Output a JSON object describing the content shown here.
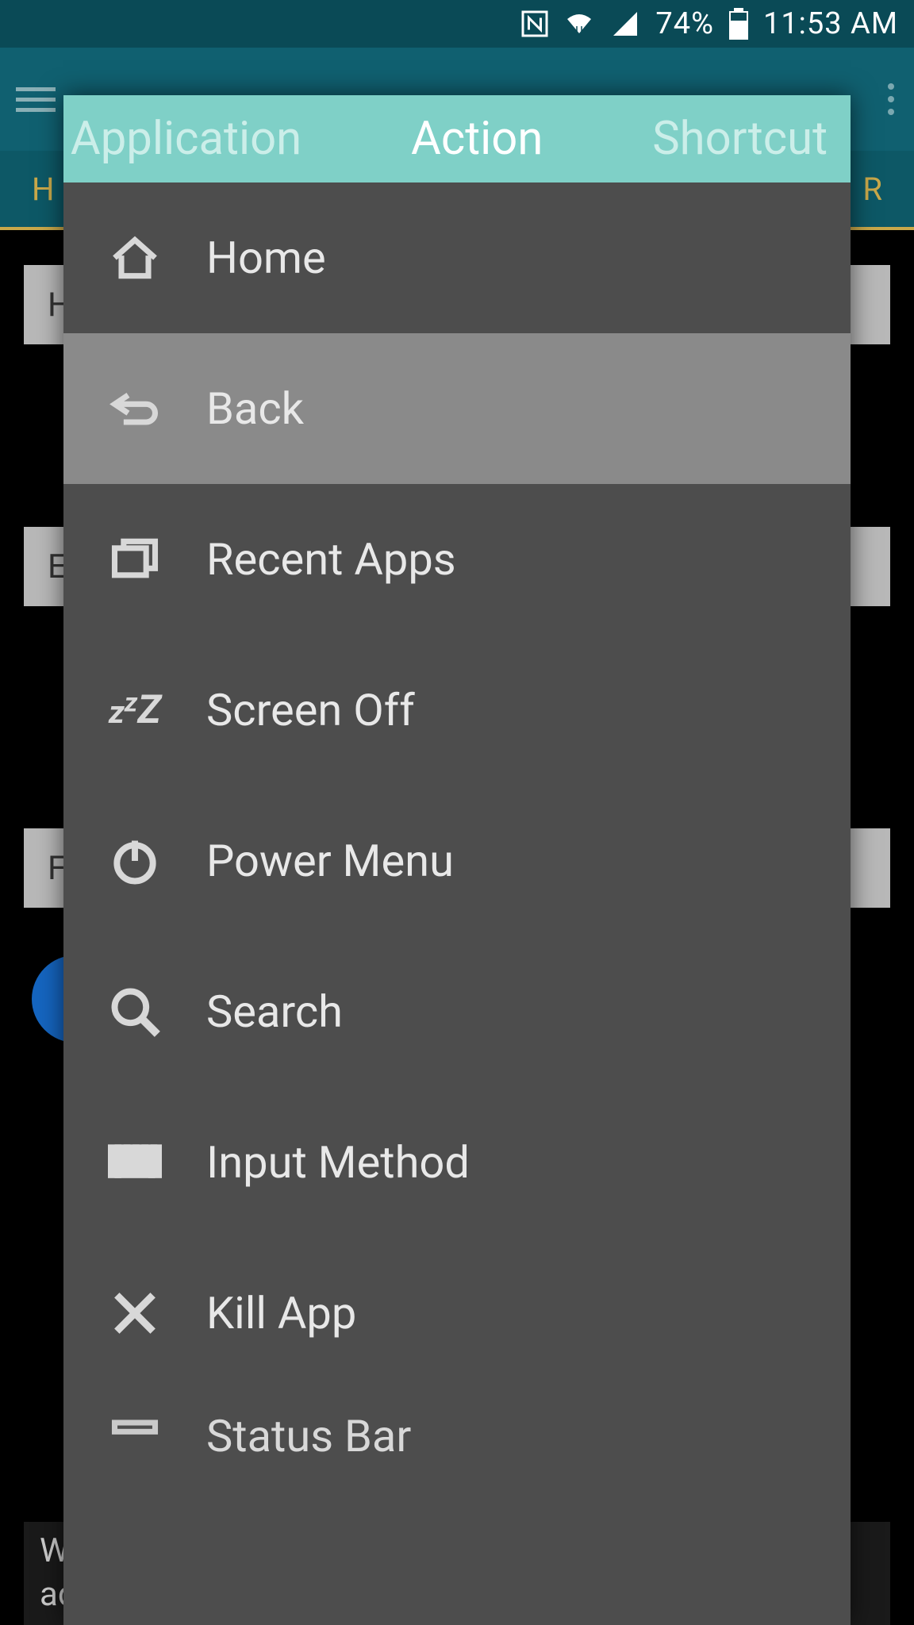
{
  "status_bar": {
    "nfc_icon": "N",
    "wifi_icon": "wifi",
    "signal_icon": "signal",
    "battery_percent": "74%",
    "battery_icon": "battery",
    "time": "11:53 AM"
  },
  "background": {
    "tabs_left_char": "H",
    "tabs_right_char": "R",
    "row1_char": "H",
    "row2_char": "E",
    "row3_char": "F",
    "footer_line1": "Wo",
    "footer_line2": "ad-free version?"
  },
  "dialog": {
    "tabs": {
      "left": "Application",
      "center": "Action",
      "right": "Shortcut"
    },
    "actions": [
      {
        "icon": "home",
        "label": "Home"
      },
      {
        "icon": "back",
        "label": "Back"
      },
      {
        "icon": "recent",
        "label": "Recent Apps"
      },
      {
        "icon": "sleep",
        "label": "Screen Off"
      },
      {
        "icon": "power",
        "label": "Power Menu"
      },
      {
        "icon": "search",
        "label": "Search"
      },
      {
        "icon": "keyboard",
        "label": "Input Method"
      },
      {
        "icon": "close",
        "label": "Kill App"
      },
      {
        "icon": "status",
        "label": "Status Bar"
      }
    ]
  }
}
